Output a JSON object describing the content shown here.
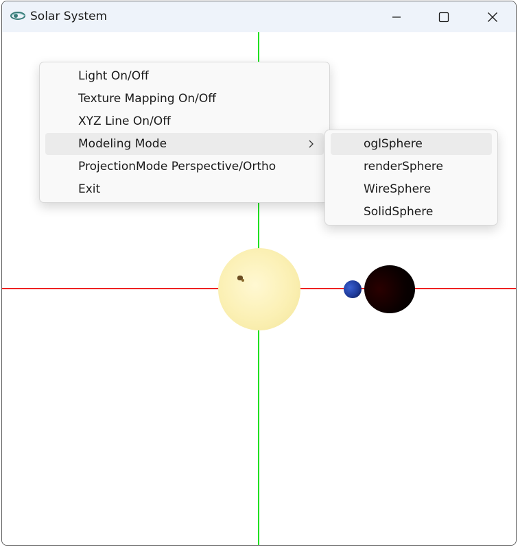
{
  "window": {
    "title": "Solar System",
    "icon": "opengl-eye-icon"
  },
  "caption_buttons": {
    "minimize": "minimize-icon",
    "maximize": "maximize-icon",
    "close": "close-icon"
  },
  "scene": {
    "x_axis_color": "#ee2222",
    "y_axis_color": "#22e022",
    "sun_color": "#fbf0b4",
    "moon_color": "#1e3a9a",
    "planet_color": "#000000"
  },
  "context_menu": {
    "items": [
      {
        "label": "Light On/Off"
      },
      {
        "label": "Texture Mapping On/Off"
      },
      {
        "label": "XYZ Line On/Off"
      },
      {
        "label": "Modeling Mode",
        "has_submenu": true,
        "highlighted": true
      },
      {
        "label": "ProjectionMode Perspective/Ortho"
      },
      {
        "label": "Exit"
      }
    ]
  },
  "submenu": {
    "items": [
      {
        "label": "oglSphere",
        "highlighted": true
      },
      {
        "label": "renderSphere"
      },
      {
        "label": "WireSphere"
      },
      {
        "label": "SolidSphere"
      }
    ]
  }
}
